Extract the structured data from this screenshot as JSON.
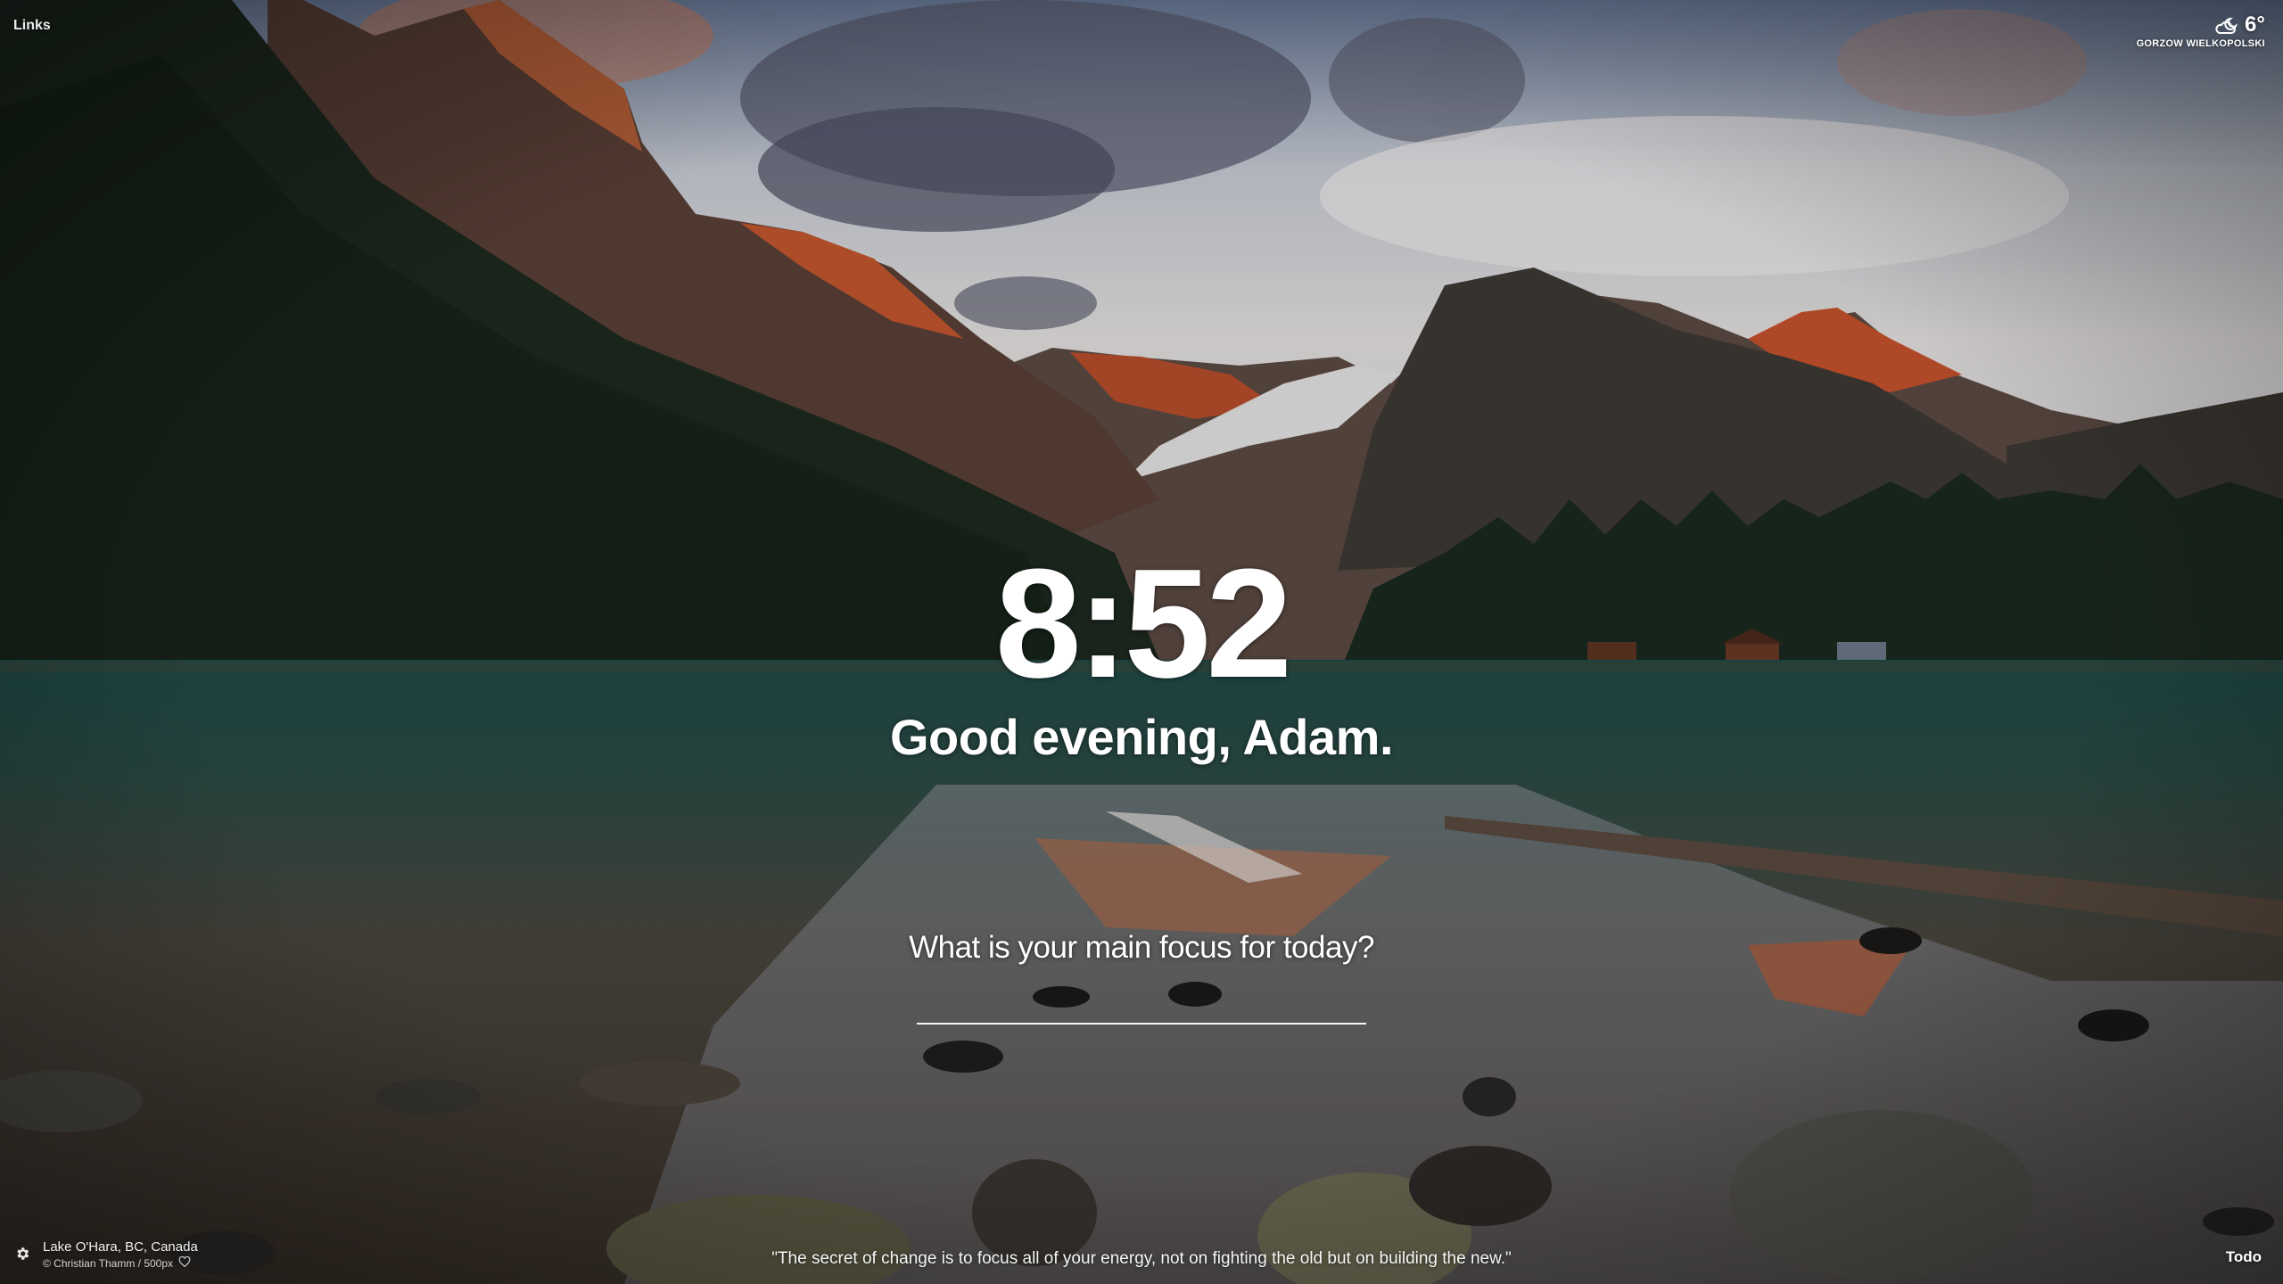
{
  "top_left": {
    "links_label": "Links"
  },
  "weather": {
    "icon": "cloud-moon-icon",
    "temperature": "6°",
    "location": "GORZOW WIELKOPOLSKI"
  },
  "center": {
    "time": "8:52",
    "greeting": "Good evening, Adam."
  },
  "focus": {
    "question": "What is your main focus for today?",
    "input_value": ""
  },
  "bottom_left": {
    "settings_icon": "gear-icon",
    "photo_location": "Lake O'Hara, BC, Canada",
    "photo_credit": "© Christian Thamm / 500px",
    "favorite_icon": "heart-icon"
  },
  "quote": {
    "text": "\"The secret of change is to focus all of your energy, not on fighting the old but on building the new.\""
  },
  "bottom_right": {
    "todo_label": "Todo"
  }
}
